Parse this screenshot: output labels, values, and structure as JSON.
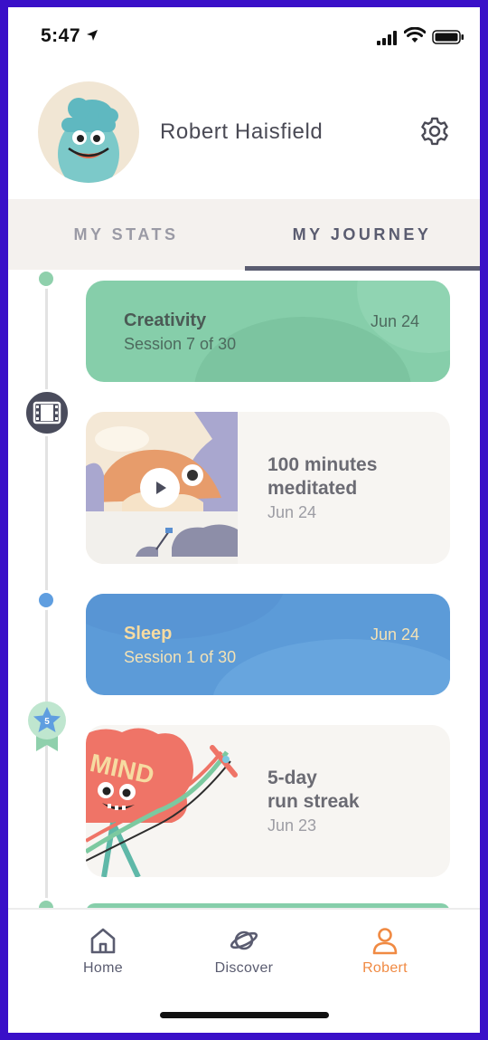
{
  "status_bar": {
    "time": "5:47"
  },
  "profile": {
    "name": "Robert Haisfield"
  },
  "tabs": [
    {
      "label": "MY STATS",
      "active": false
    },
    {
      "label": "MY JOURNEY",
      "active": true
    }
  ],
  "timeline": [
    {
      "kind": "session",
      "title": "Creativity",
      "subtitle": "Session 7 of 30",
      "date": "Jun 24",
      "color": "#86ceaa"
    },
    {
      "kind": "milestone",
      "title_line1": "100 minutes",
      "title_line2": "meditated",
      "date": "Jun 24",
      "icon": "film-icon"
    },
    {
      "kind": "session",
      "title": "Sleep",
      "subtitle": "Session 1 of 30",
      "date": "Jun 24",
      "color": "#5c9bd8"
    },
    {
      "kind": "milestone",
      "title_line1": "5-day",
      "title_line2": "run streak",
      "date": "Jun 23",
      "icon": "star-medal-icon",
      "badge_number": "5",
      "art_text": "MIND"
    }
  ],
  "bottom_nav": [
    {
      "label": "Home",
      "icon": "home-icon",
      "active": false
    },
    {
      "label": "Discover",
      "icon": "planet-icon",
      "active": false
    },
    {
      "label": "Robert",
      "icon": "person-icon",
      "active": true
    }
  ],
  "colors": {
    "accent_active_nav": "#f08a43",
    "tab_active": "#5a5c70",
    "frame": "#3a10c8"
  }
}
